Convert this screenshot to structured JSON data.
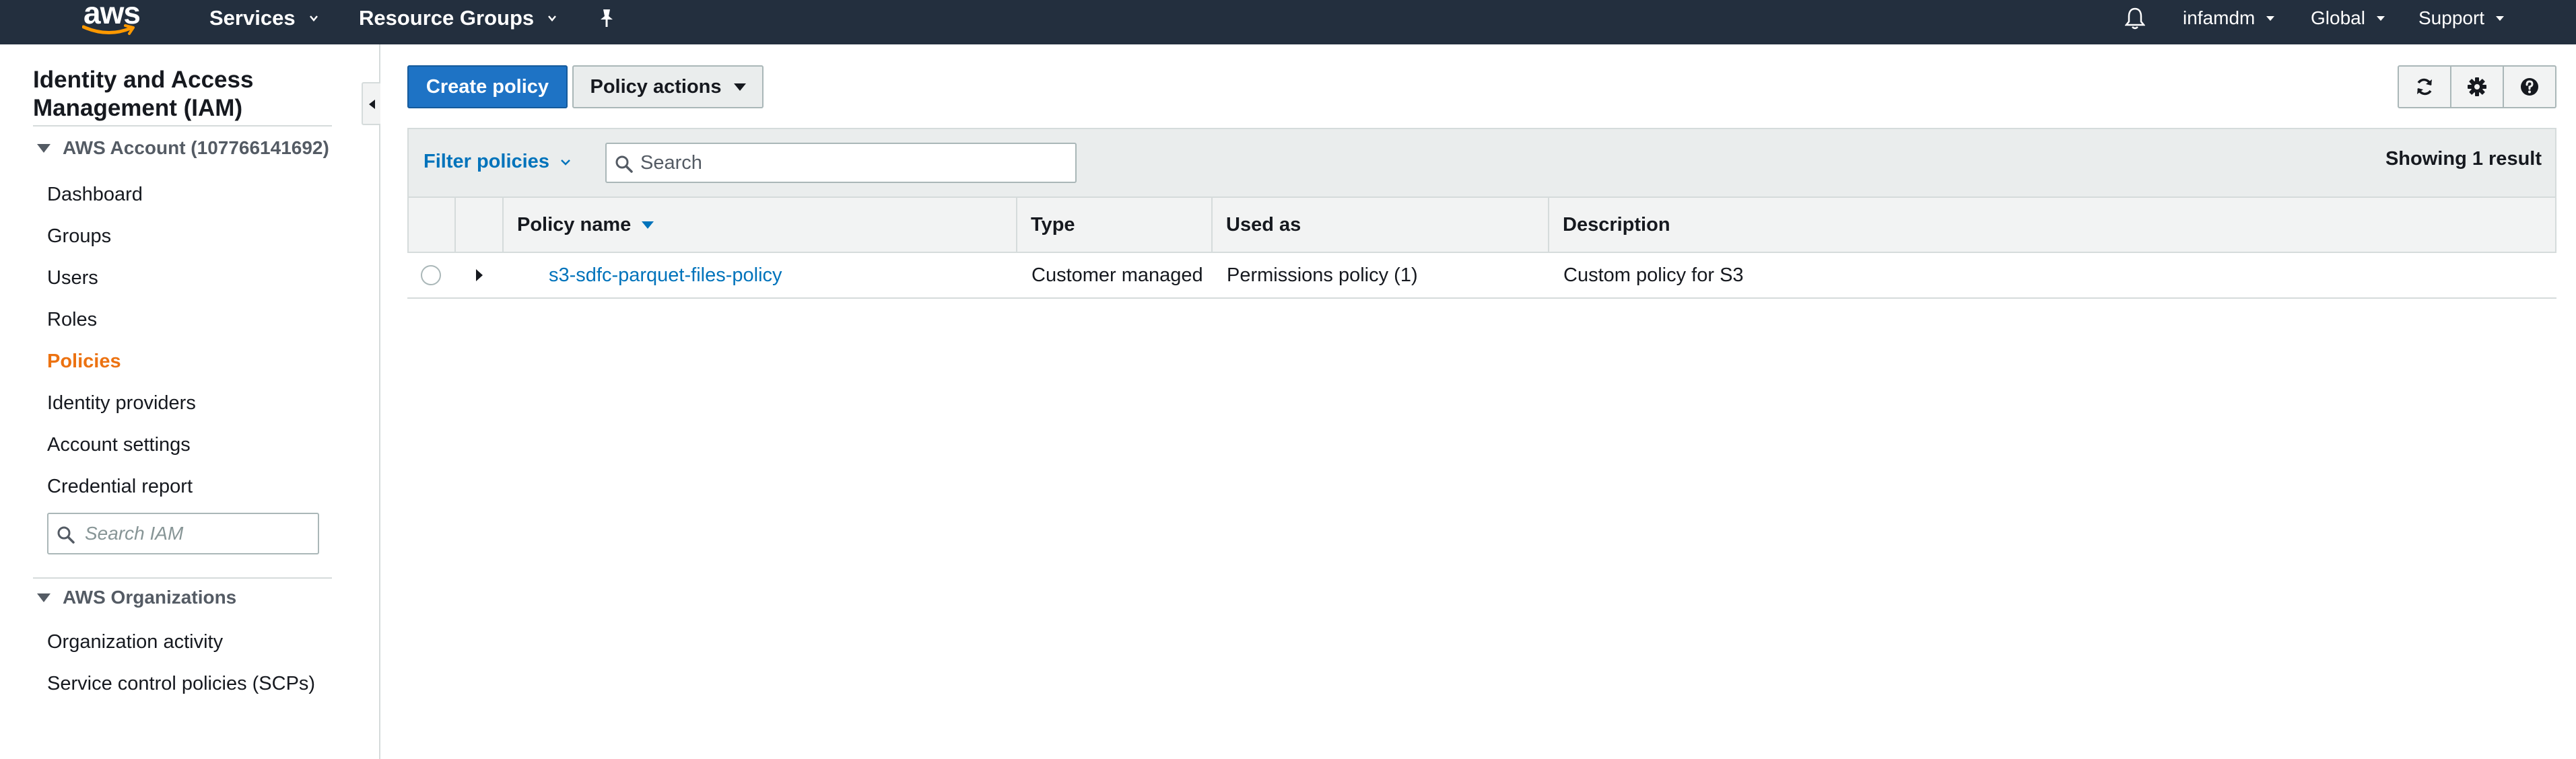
{
  "topnav": {
    "logo": "aws",
    "services": "Services",
    "resource_groups": "Resource Groups",
    "pin_icon": "pin-icon",
    "bell_icon": "bell-icon",
    "user": "infamdm",
    "region": "Global",
    "support": "Support"
  },
  "sidebar": {
    "title": "Identity and Access Management (IAM)",
    "account_section": "AWS Account (107766141692)",
    "items": [
      {
        "label": "Dashboard"
      },
      {
        "label": "Groups"
      },
      {
        "label": "Users"
      },
      {
        "label": "Roles"
      },
      {
        "label": "Policies",
        "active": true
      },
      {
        "label": "Identity providers"
      },
      {
        "label": "Account settings"
      },
      {
        "label": "Credential report"
      }
    ],
    "search_placeholder": "Search IAM",
    "org_section": "AWS Organizations",
    "org_items": [
      {
        "label": "Organization activity"
      },
      {
        "label": "Service control policies (SCPs)"
      }
    ]
  },
  "toolbar": {
    "create_policy": "Create policy",
    "policy_actions": "Policy actions",
    "icons": [
      "refresh-icon",
      "gear-icon",
      "help-icon"
    ]
  },
  "filter": {
    "label": "Filter policies",
    "search_placeholder": "Search",
    "result_count": "Showing 1 result"
  },
  "table": {
    "columns": [
      "Policy name",
      "Type",
      "Used as",
      "Description"
    ],
    "rows": [
      {
        "policy_name": "s3-sdfc-parquet-files-policy",
        "type": "Customer managed",
        "used_as": "Permissions policy (1)",
        "description": "Custom policy for S3"
      }
    ]
  },
  "colors": {
    "nav_bg": "#232f3e",
    "primary": "#1e73c5",
    "link": "#0073bb",
    "active": "#ec7211"
  }
}
